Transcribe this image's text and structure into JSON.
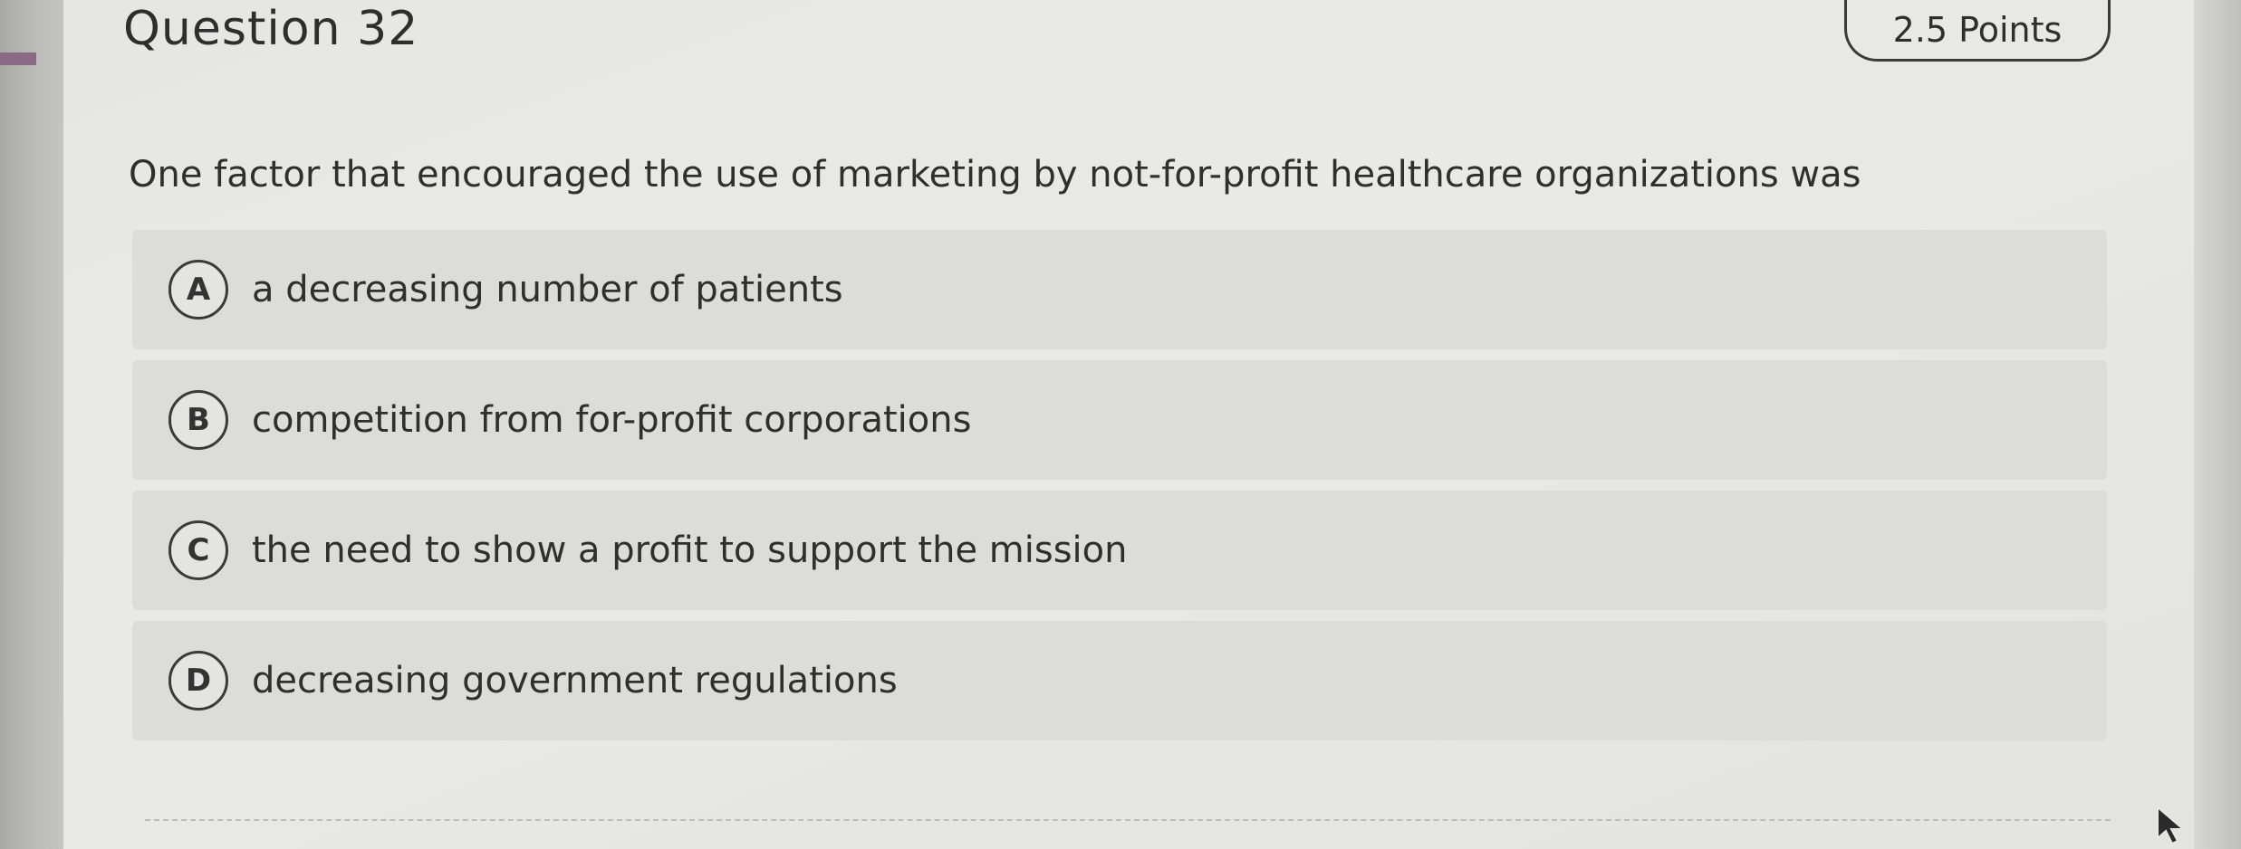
{
  "question": {
    "title": "Question 32",
    "points": "2.5 Points",
    "prompt": "One factor that encouraged the use of marketing by not-for-profit healthcare organizations was"
  },
  "choices": [
    {
      "letter": "A",
      "text": "a decreasing number of patients"
    },
    {
      "letter": "B",
      "text": "competition from for-profit corporations"
    },
    {
      "letter": "C",
      "text": "the need to show a profit to support the mission"
    },
    {
      "letter": "D",
      "text": "decreasing government regulations"
    }
  ],
  "colors": {
    "page_bg": "#c9c9c7",
    "card_bg": "#e6e6e4",
    "choice_bg": "#dcdcda",
    "text": "#2f2f2f"
  },
  "icons": {
    "cursor": "mouse-pointer-icon"
  }
}
